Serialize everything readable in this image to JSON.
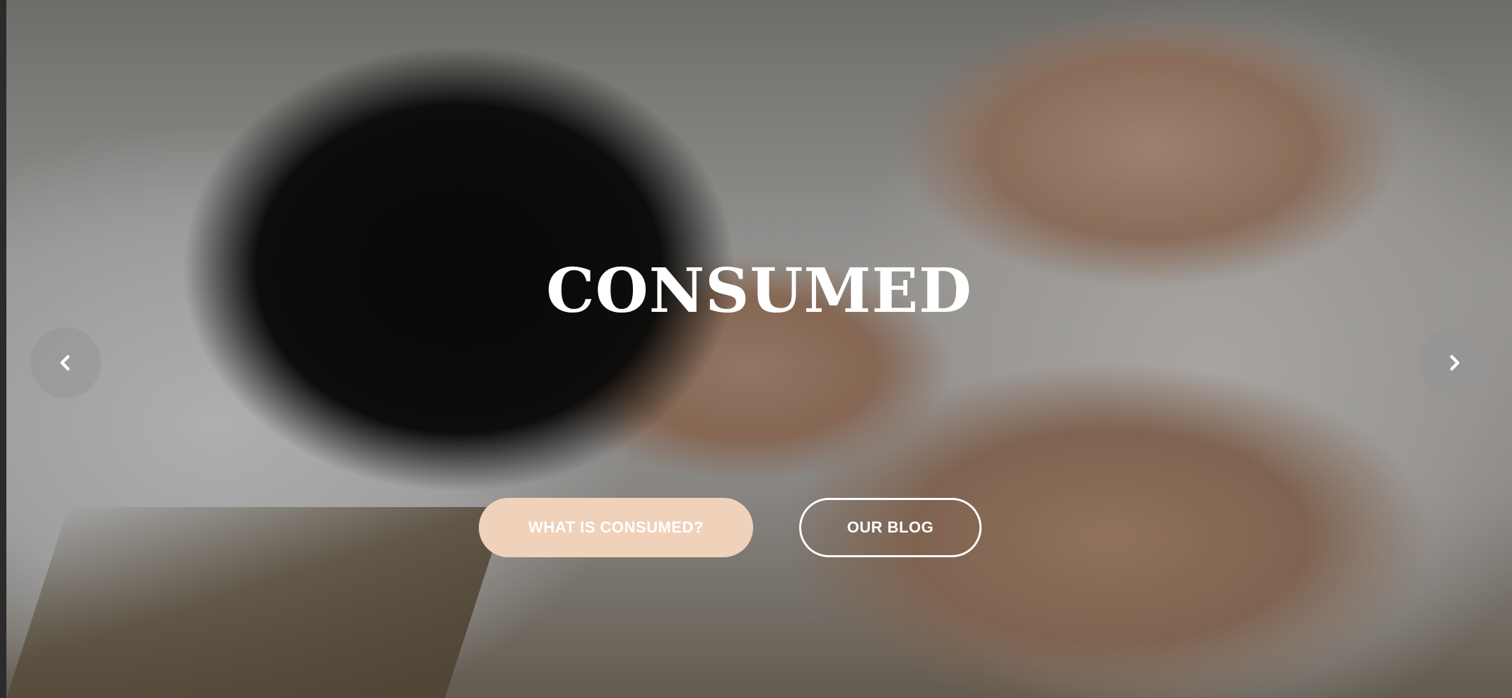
{
  "hero": {
    "title": "CONSUMED",
    "primary_button_label": "WHAT IS CONSUMED?",
    "secondary_button_label": "OUR BLOG"
  },
  "slider": {
    "prev_icon": "chevron-left-icon",
    "next_icon": "chevron-right-icon"
  },
  "colors": {
    "primary_button_bg": "#f0d2ba",
    "button_text": "#ffffff",
    "arrow_bg": "#969696"
  }
}
